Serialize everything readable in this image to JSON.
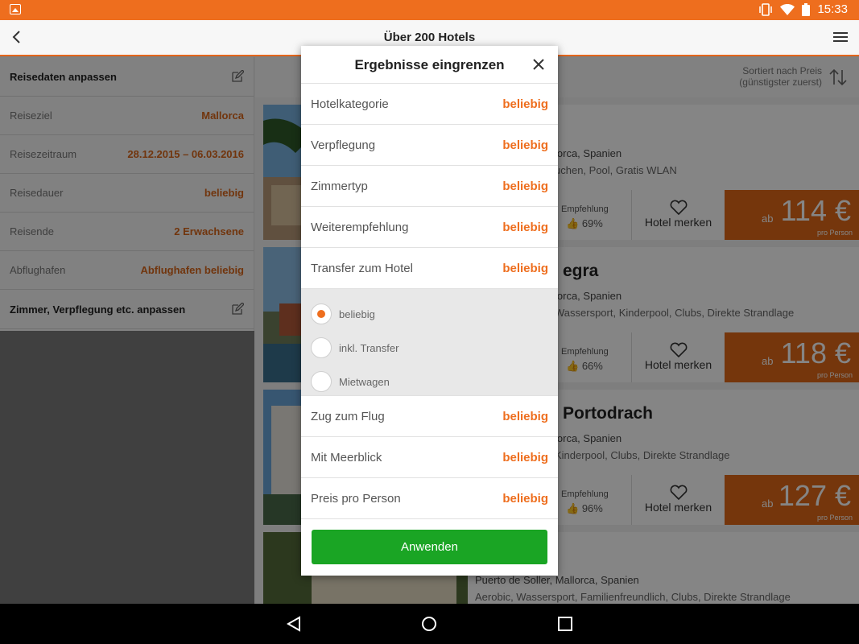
{
  "status": {
    "time": "15:33"
  },
  "appbar": {
    "title": "Über 200 Hotels"
  },
  "sidebar": {
    "head1": "Reisedaten anpassen",
    "rows": [
      {
        "label": "Reiseziel",
        "value": "Mallorca"
      },
      {
        "label": "Reisezeitraum",
        "value": "28.12.2015 – 06.03.2016"
      },
      {
        "label": "Reisedauer",
        "value": "beliebig"
      },
      {
        "label": "Reisende",
        "value": "2 Erwachsene"
      },
      {
        "label": "Abflughafen",
        "value": "Abflughafen beliebig"
      }
    ],
    "head2": "Zimmer, Verpflegung etc. anpassen"
  },
  "sort": {
    "line1": "Sortiert nach Preis",
    "line2": "(günstigster zuerst)"
  },
  "hotels": [
    {
      "name": "",
      "location": "lorca, Spanien",
      "features": "uchen, Pool, Gratis WLAN",
      "rec_label": "Empfehlung",
      "rec_value": "69%",
      "merk": "Hotel merken",
      "ab": "ab",
      "price": "114 €",
      "pp": "pro Person"
    },
    {
      "name": "egra",
      "location": "lorca, Spanien",
      "features": "Wassersport, Kinderpool, Clubs, Direkte Strandlage",
      "rec_label": "Empfehlung",
      "rec_value": "66%",
      "merk": "Hotel merken",
      "ab": "ab",
      "price": "118 €",
      "pp": "pro Person"
    },
    {
      "name": "Portodrach",
      "location": "lorca, Spanien",
      "features": "Kinderpool, Clubs, Direkte Strandlage",
      "rec_label": "Empfehlung",
      "rec_value": "96%",
      "merk": "Hotel merken",
      "ab": "ab",
      "price": "127 €",
      "pp": "pro Person"
    },
    {
      "name": "",
      "location": "Puerto de Soller, Mallorca, Spanien",
      "features": "Aerobic, Wassersport, Familienfreundlich, Clubs, Direkte Strandlage"
    }
  ],
  "modal": {
    "title": "Ergebnisse eingrenzen",
    "filters_top": [
      {
        "label": "Hotelkategorie",
        "value": "beliebig"
      },
      {
        "label": "Verpflegung",
        "value": "beliebig"
      },
      {
        "label": "Zimmertyp",
        "value": "beliebig"
      },
      {
        "label": "Weiterempfehlung",
        "value": "beliebig"
      },
      {
        "label": "Transfer zum Hotel",
        "value": "beliebig"
      }
    ],
    "transfer_options": [
      {
        "label": "beliebig",
        "selected": true
      },
      {
        "label": "inkl. Transfer",
        "selected": false
      },
      {
        "label": "Mietwagen",
        "selected": false
      }
    ],
    "filters_bottom": [
      {
        "label": "Zug zum Flug",
        "value": "beliebig"
      },
      {
        "label": "Mit Meerblick",
        "value": "beliebig"
      },
      {
        "label": "Preis pro Person",
        "value": "beliebig"
      }
    ],
    "apply_label": "Anwenden"
  },
  "colors": {
    "accent": "#ee6e1e",
    "price_bg": "#e06818",
    "apply": "#1aa524"
  }
}
